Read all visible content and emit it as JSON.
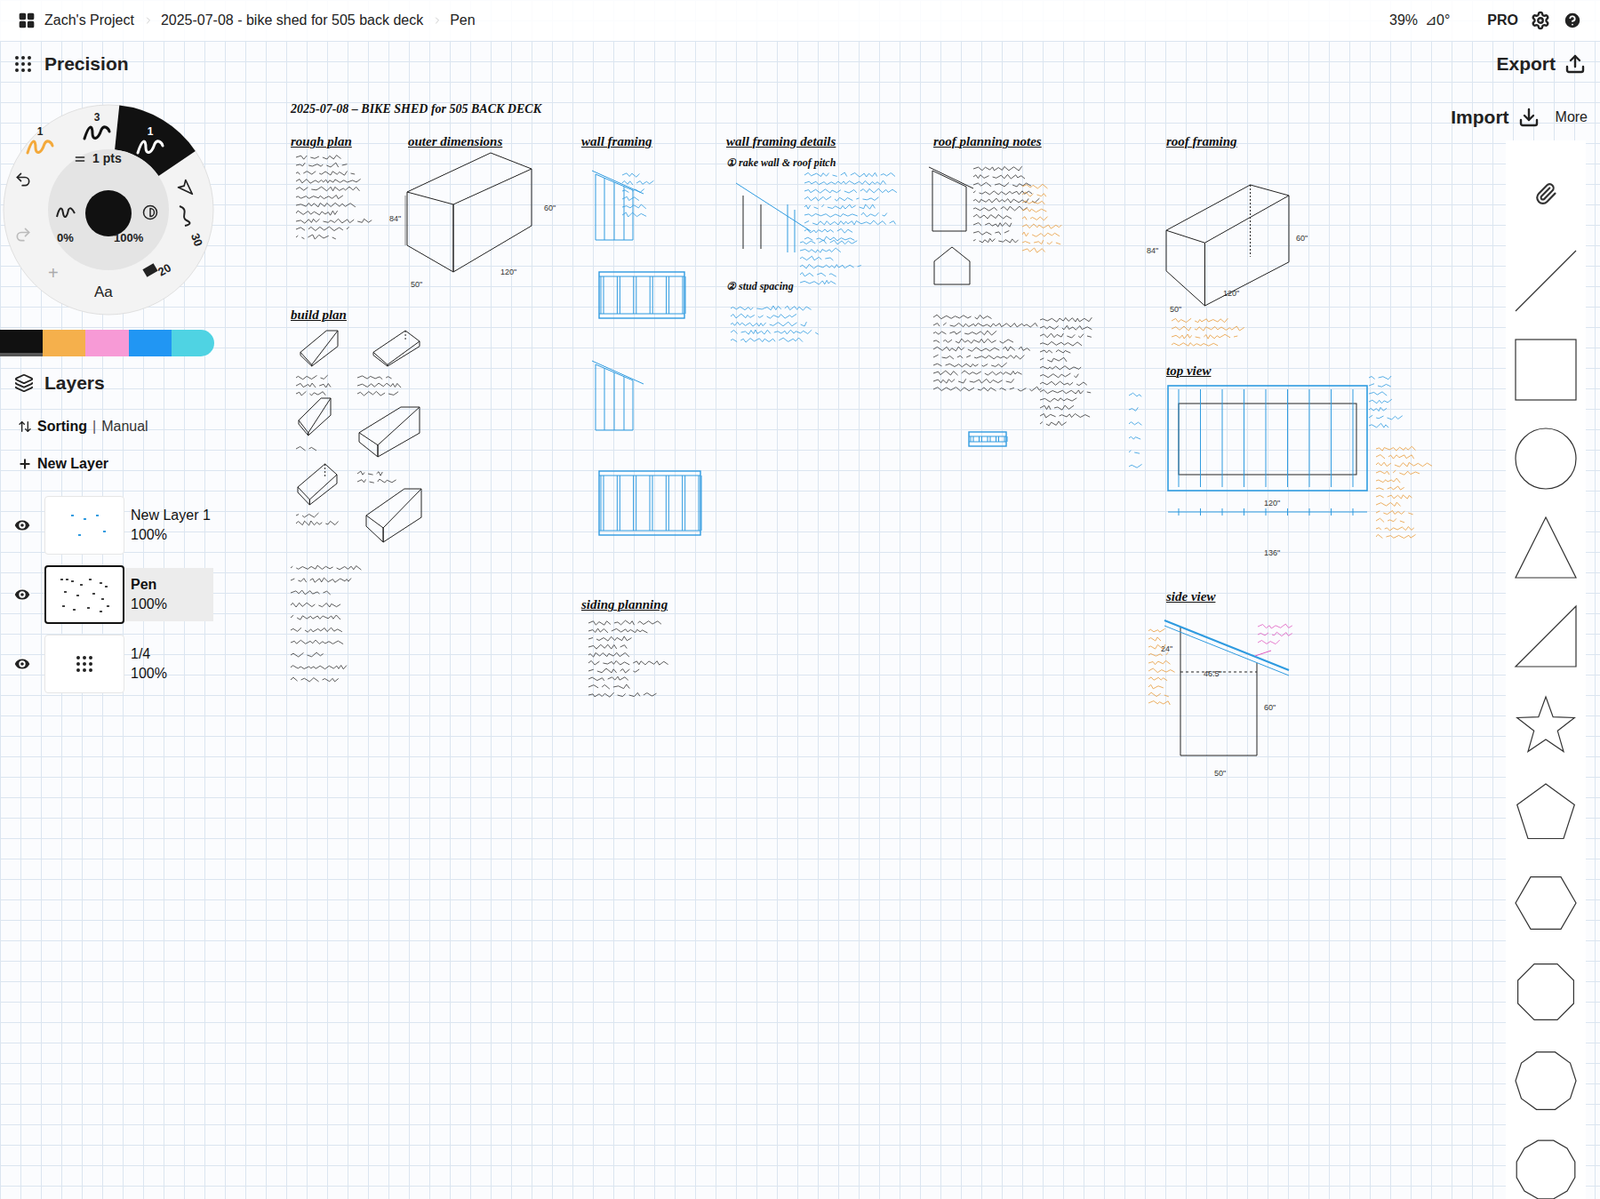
{
  "topbar": {
    "breadcrumbs": [
      {
        "label": "Zach's Project"
      },
      {
        "label": "2025-07-08 - bike shed for 505 back deck"
      },
      {
        "label": "Pen"
      }
    ],
    "zoom": "39%",
    "angle": "⊿0°",
    "plan": "PRO"
  },
  "toolbar": {
    "mode": "Precision",
    "export": "Export",
    "import": "Import",
    "more": "More"
  },
  "tool_wheel": {
    "brushes": [
      {
        "label": "1",
        "selected": false,
        "color": "#f3a93b"
      },
      {
        "label": "3",
        "selected": false,
        "color": "#111111"
      },
      {
        "label": "1",
        "selected": true,
        "color": "#111111"
      }
    ],
    "size": "1 pts",
    "opacity": "0%",
    "smoothing": "100%",
    "presets": [
      "30",
      "20"
    ],
    "text_tool": "Aa",
    "add": "+"
  },
  "colors": [
    {
      "color": "#111111",
      "selected": true
    },
    {
      "color": "#f5b04c",
      "selected": false
    },
    {
      "color": "#f79ad6",
      "selected": false
    },
    {
      "color": "#2196f3",
      "selected": false
    },
    {
      "color": "#4fd3e3",
      "selected": false
    }
  ],
  "layers": {
    "title": "Layers",
    "sorting_label": "Sorting",
    "sorting_separator": "|",
    "sorting_value": "Manual",
    "new_layer": "New Layer",
    "items": [
      {
        "name": "New Layer 1",
        "opacity": "100%",
        "visible": true,
        "selected": false,
        "kind": "sketch"
      },
      {
        "name": "Pen",
        "opacity": "100%",
        "visible": true,
        "selected": true,
        "kind": "drawing"
      },
      {
        "name": "1/4",
        "opacity": "100%",
        "visible": true,
        "selected": false,
        "kind": "grid"
      }
    ]
  },
  "canvas": {
    "title": "2025-07-08 – BIKE SHED for 505 BACK DECK",
    "sections": [
      {
        "heading": "rough plan"
      },
      {
        "heading": "outer dimensions"
      },
      {
        "heading": "wall framing"
      },
      {
        "heading": "wall framing details"
      },
      {
        "heading": "roof planning notes"
      },
      {
        "heading": "roof framing"
      },
      {
        "heading": "build plan"
      },
      {
        "heading": "siding planning"
      },
      {
        "heading": "top view"
      },
      {
        "heading": "side view"
      }
    ],
    "subheadings": [
      "① rake wall & roof pitch",
      "② stud spacing"
    ],
    "dimensions": [
      "84\"",
      "60\"",
      "50\"",
      "120\"",
      "84\"",
      "60\"",
      "50\"",
      "120\"",
      "120\"",
      "136\"",
      "24\"",
      "46.5\"",
      "60\"",
      "50\""
    ]
  }
}
